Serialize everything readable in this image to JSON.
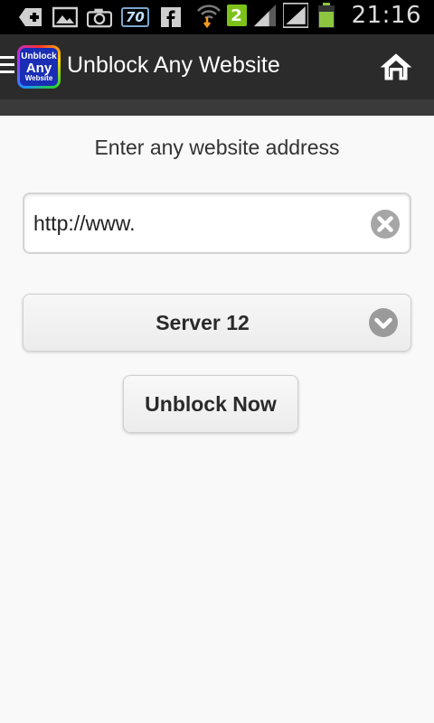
{
  "status_bar": {
    "time": "21:16",
    "notification_badge": "70",
    "sim_badge": "2",
    "icons": [
      "add-icon",
      "image-icon",
      "camera-icon",
      "notification-70-icon",
      "facebook-icon",
      "wifi-download-icon",
      "sim-2-icon",
      "signal-icon",
      "signal-icon",
      "battery-icon"
    ],
    "battery_color": "#8cc63f"
  },
  "action_bar": {
    "logo": {
      "line1": "Unblock",
      "line2": "Any",
      "line3": "Website"
    },
    "title": "Unblock Any Website",
    "menu_icon": "hamburger-icon",
    "home_icon": "home-icon",
    "background": "#2b2b2b"
  },
  "main": {
    "prompt": "Enter any website address",
    "url_input": {
      "value": "http://www.",
      "clear_icon": "clear-icon"
    },
    "server_select": {
      "selected": "Server 12",
      "icon": "chevron-down-icon"
    },
    "submit_label": "Unblock Now"
  }
}
